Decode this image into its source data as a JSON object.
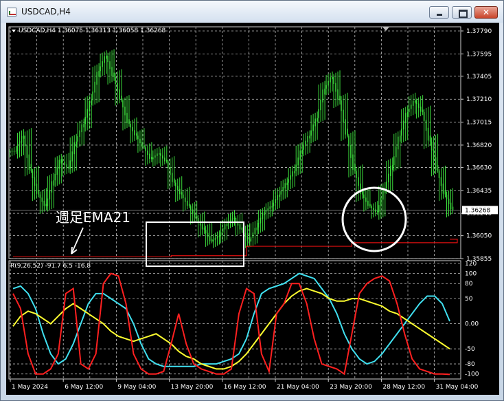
{
  "window": {
    "title": "USDCAD,H4",
    "controls": {
      "minimize": "minimize-button",
      "maximize": "maximize-button",
      "close": "close-button"
    }
  },
  "chart_header": "USDCAD,H4  1.36075 1.36313 1.36058 1.36268",
  "price_axis": [
    "1.37790",
    "1.37595",
    "1.37405",
    "1.37210",
    "1.37015",
    "1.36820",
    "1.36630",
    "1.36435",
    "1.36240",
    "1.36050",
    "1.35855"
  ],
  "current_price": "1.36268",
  "annotation": "週足EMA21",
  "indicator_header": "R(9,26,52) -91.7 6.5 -16.8",
  "indicator_axis": [
    "120",
    "100",
    "80",
    "50",
    "0.00",
    "-50",
    "-80",
    "-100"
  ],
  "time_axis": [
    "1 May 2024",
    "6 May 12:00",
    "9 May 04:00",
    "13 May 20:00",
    "16 May 12:00",
    "21 May 04:00",
    "23 May 20:00",
    "28 May 12:00",
    "31 May 04:00"
  ],
  "colors": {
    "candles": "#3cdc3c",
    "ema": "#e01010",
    "grid": "#bcbcbc",
    "rci_fast": "#ff2020",
    "rci_mid": "#ffff30",
    "rci_slow": "#40e0f0",
    "highlight": "#ffffff"
  },
  "chart_data": {
    "type": "line",
    "price_series": {
      "name": "USDCAD,H4",
      "ylim": [
        1.35855,
        1.3779
      ],
      "close": [
        1.3677,
        1.369,
        1.366,
        1.364,
        1.363,
        1.3652,
        1.367,
        1.3662,
        1.3685,
        1.37,
        1.372,
        1.3745,
        1.3758,
        1.374,
        1.372,
        1.37,
        1.369,
        1.368,
        1.367,
        1.3675,
        1.3668,
        1.365,
        1.364,
        1.363,
        1.362,
        1.361,
        1.36,
        1.3605,
        1.3615,
        1.362,
        1.361,
        1.36,
        1.3612,
        1.3625,
        1.363,
        1.364,
        1.365,
        1.366,
        1.3678,
        1.369,
        1.3705,
        1.373,
        1.374,
        1.372,
        1.369,
        1.366,
        1.364,
        1.363,
        1.3625,
        1.3645,
        1.3665,
        1.369,
        1.371,
        1.372,
        1.371,
        1.3685,
        1.366,
        1.364,
        1.3627
      ]
    },
    "ema_series": {
      "name": "週足EMA21",
      "steps": [
        [
          0,
          1.3587
        ],
        [
          21,
          1.3588
        ],
        [
          31,
          1.3596
        ],
        [
          45,
          1.3599
        ],
        [
          59,
          1.3602
        ]
      ]
    },
    "indicator": {
      "name": "R(9,26,52)",
      "ylim": [
        -110,
        120
      ],
      "values_last": [
        -91.7,
        6.5,
        -16.8
      ],
      "fast": [
        60,
        30,
        -60,
        -100,
        -100,
        -90,
        -60,
        60,
        70,
        -80,
        -90,
        -60,
        80,
        100,
        95,
        40,
        -60,
        -90,
        -100,
        -100,
        -95,
        -40,
        20,
        -40,
        -80,
        -90,
        -95,
        -100,
        -100,
        -90,
        20,
        70,
        60,
        -60,
        -95,
        20,
        40,
        80,
        80,
        40,
        -30,
        -80,
        -85,
        -90,
        -100,
        -20,
        60,
        80,
        90,
        95,
        85,
        40,
        -20,
        -70,
        -90,
        -95,
        -100,
        -100,
        -101
      ],
      "mid": [
        -5,
        15,
        25,
        20,
        10,
        0,
        15,
        30,
        40,
        30,
        20,
        10,
        0,
        -15,
        -25,
        -30,
        -35,
        -30,
        -25,
        -20,
        -30,
        -40,
        -55,
        -65,
        -70,
        -80,
        -85,
        -90,
        -90,
        -85,
        -75,
        -60,
        -40,
        -20,
        0,
        20,
        40,
        55,
        65,
        70,
        65,
        60,
        50,
        45,
        45,
        50,
        50,
        45,
        40,
        35,
        25,
        20,
        10,
        0,
        -10,
        -20,
        -30,
        -40,
        -50
      ],
      "slow": [
        70,
        75,
        60,
        30,
        -20,
        -60,
        -80,
        -70,
        -40,
        0,
        40,
        60,
        60,
        50,
        40,
        30,
        0,
        -40,
        -70,
        -80,
        -85,
        -85,
        -85,
        -85,
        -85,
        -80,
        -80,
        -80,
        -75,
        -70,
        -60,
        -30,
        20,
        60,
        70,
        75,
        80,
        90,
        100,
        95,
        90,
        70,
        50,
        20,
        -20,
        -50,
        -70,
        -80,
        -75,
        -60,
        -40,
        -20,
        0,
        20,
        40,
        55,
        55,
        40,
        5
      ]
    }
  }
}
